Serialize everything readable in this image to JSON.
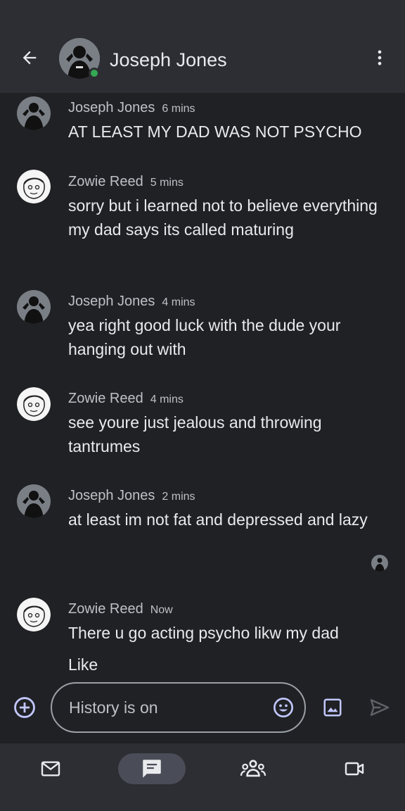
{
  "header": {
    "title": "Joseph Jones",
    "back_icon": "arrow-back-icon",
    "more_icon": "more-vert-icon"
  },
  "messages": [
    {
      "sender": "Joseph Jones",
      "time": "6 mins",
      "text": "AT LEAST MY DAD WAS NOT PSYCHO",
      "avatar": "avatar-joseph"
    },
    {
      "sender": "Zowie Reed",
      "time": "5 mins",
      "text": "sorry but i learned not to believe everything my dad says its called maturing",
      "avatar": "avatar-zowie"
    },
    {
      "sender": "Joseph Jones",
      "time": "4 mins",
      "text": "yea right good luck with the dude your hanging out with",
      "avatar": "avatar-joseph"
    },
    {
      "sender": "Zowie Reed",
      "time": "4 mins",
      "text": "see youre just jealous and throwing tantrumes",
      "avatar": "avatar-zowie"
    },
    {
      "sender": "Joseph Jones",
      "time": "2 mins",
      "text": "at least im not fat and depressed and lazy",
      "avatar": "avatar-joseph"
    },
    {
      "sender": "Zowie Reed",
      "time": "Now",
      "text": "There u go acting psycho likw my dad",
      "avatar": "avatar-zowie"
    }
  ],
  "partial_message": "Like",
  "composer": {
    "placeholder": "History is on",
    "add_icon": "add-circle-icon",
    "emoji_icon": "emoji-icon",
    "image_icon": "image-icon",
    "send_icon": "send-icon"
  },
  "bottom_nav": [
    {
      "icon": "mail-icon",
      "active": false
    },
    {
      "icon": "chat-icon",
      "active": true
    },
    {
      "icon": "spaces-icon",
      "active": false
    },
    {
      "icon": "video-icon",
      "active": false
    }
  ],
  "colors": {
    "background": "#202124",
    "topbar": "#2d2e33",
    "accent": "#aecbfa",
    "online": "#34a853"
  }
}
